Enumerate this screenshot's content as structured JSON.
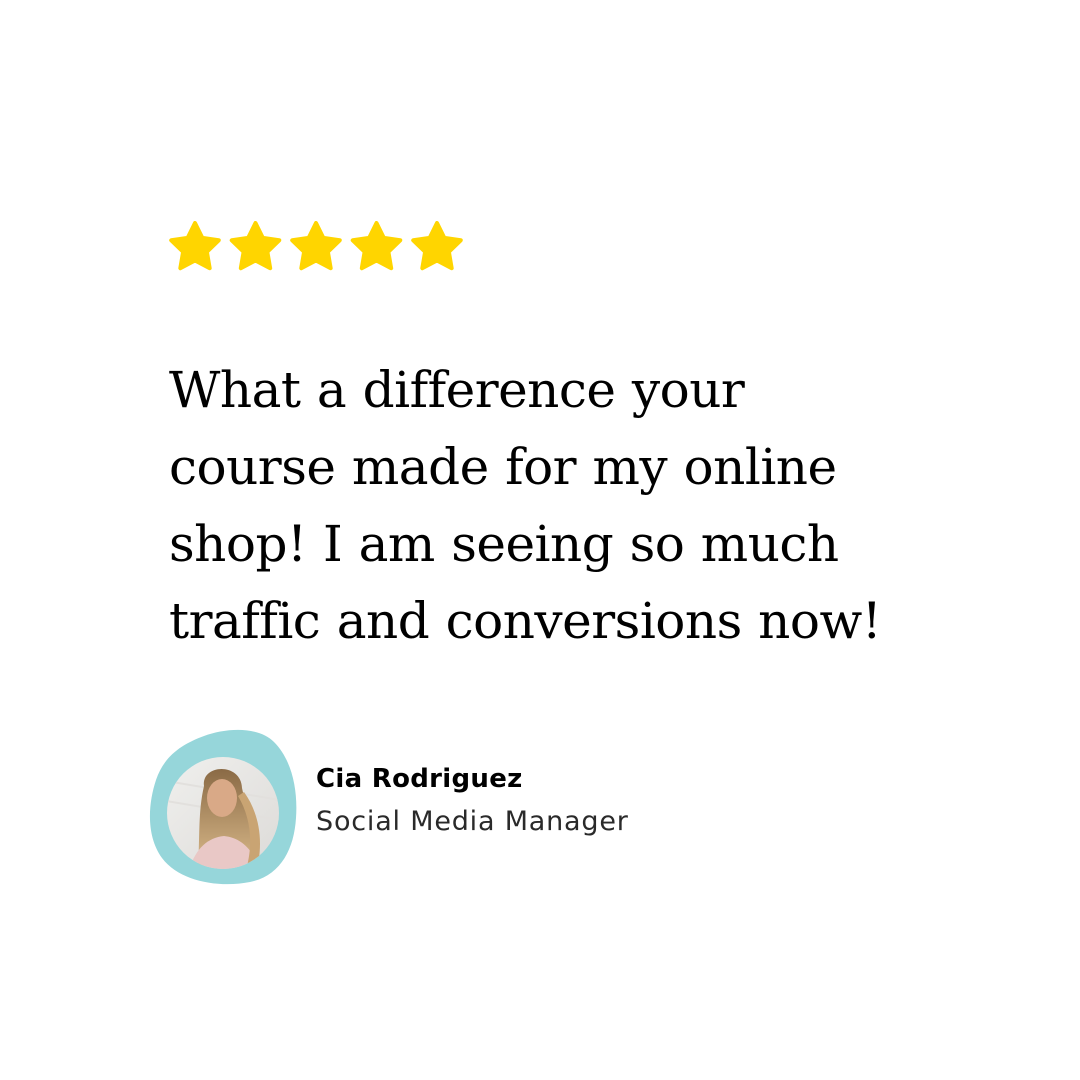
{
  "rating": {
    "stars": 5,
    "max": 5,
    "color": "#FFD500",
    "icon": "star-icon"
  },
  "quote": {
    "lines": [
      "What a difference your",
      "course made for my online",
      "shop! I am seeing so much",
      "traffic and conversions now!"
    ]
  },
  "author": {
    "name": "Cia Rodriguez",
    "role": "Social Media Manager",
    "blob_color": "#96D6DA",
    "avatar_icon": "avatar-photo"
  }
}
